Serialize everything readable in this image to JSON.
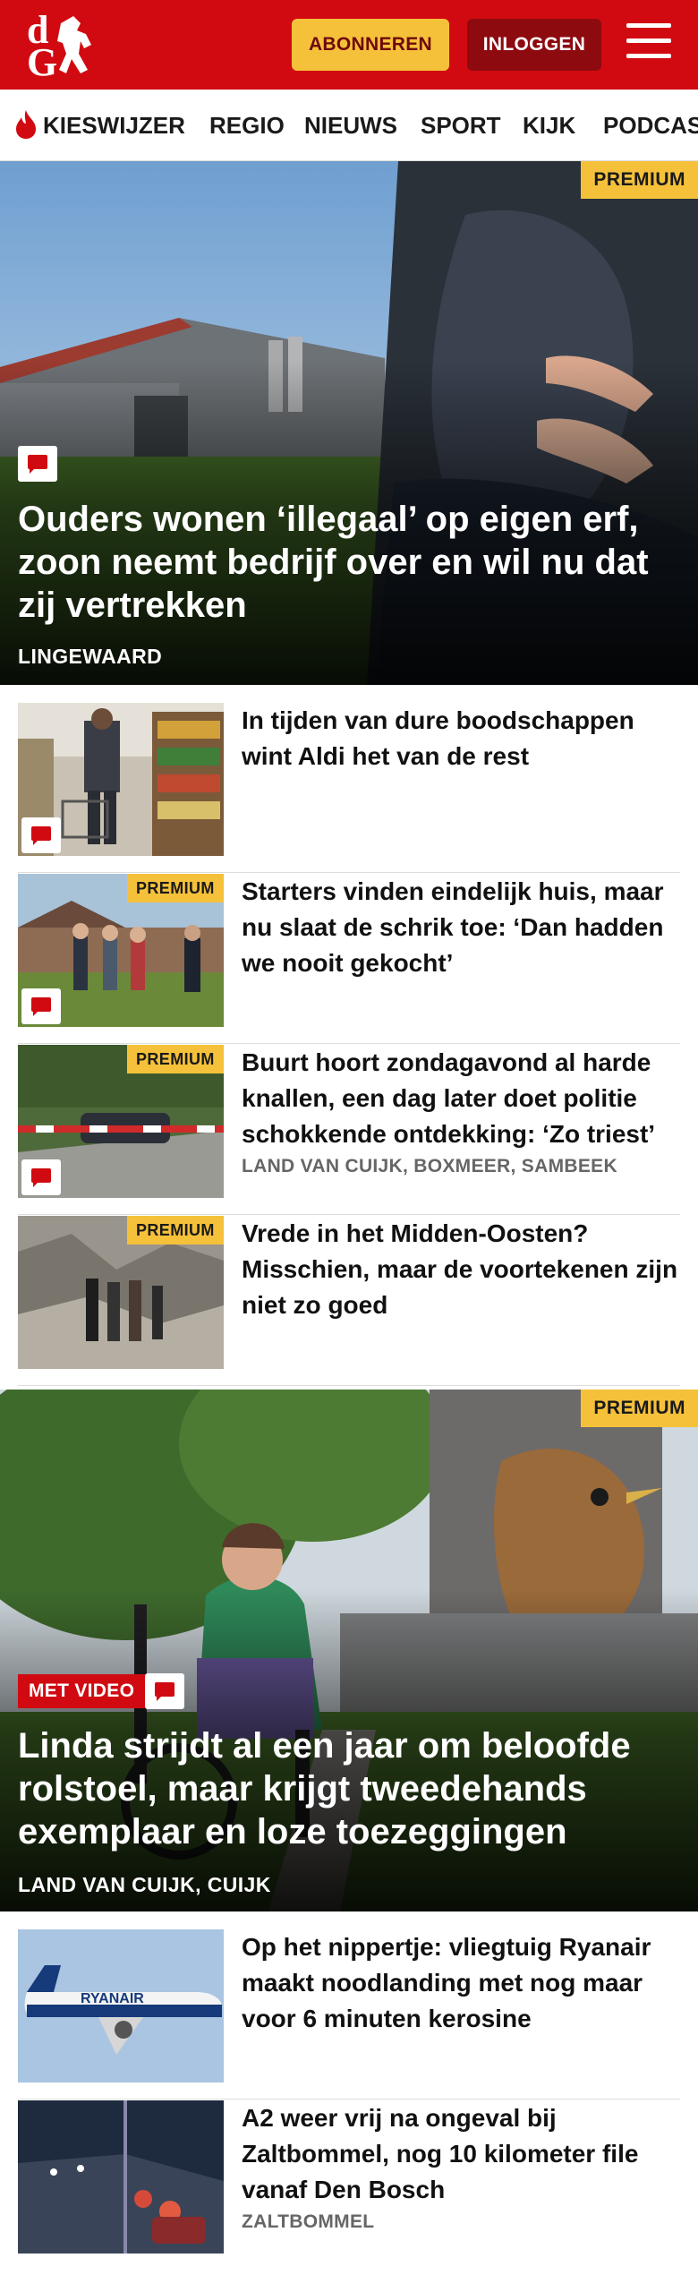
{
  "header": {
    "subscribe_label": "ABONNEREN",
    "login_label": "INLOGGEN",
    "menu_icon": "hamburger-icon",
    "brand_color": "#d10a11"
  },
  "nav": {
    "items": [
      "KIESWIJZER",
      "REGIO",
      "NIEUWS",
      "SPORT",
      "KIJK",
      "PODCAST"
    ]
  },
  "hero1": {
    "badge": "PREMIUM",
    "title": "Ouders wonen ‘illegaal’ op eigen erf, zoon neemt bedrijf over en wil nu dat zij vertrekken",
    "location": "LINGEWAARD"
  },
  "articles": [
    {
      "title": "In tijden van dure boodschappen wint Aldi het van de rest",
      "badge": "",
      "location": ""
    },
    {
      "title": "Starters vinden eindelijk huis, maar nu slaat de schrik toe: ‘Dan hadden we nooit gekocht’",
      "badge": "PREMIUM",
      "location": ""
    },
    {
      "title": "Buurt hoort zondagavond al harde knallen, een dag later doet politie schokkende ontdekking: ‘Zo triest’",
      "badge": "PREMIUM",
      "location": "LAND VAN CUIJK, BOXMEER, SAMBEEK"
    },
    {
      "title": "Vrede in het Midden-Oosten? Misschien, maar de voortekenen zijn niet zo goed",
      "badge": "PREMIUM",
      "location": ""
    }
  ],
  "hero2": {
    "badge": "PREMIUM",
    "video_label": "MET VIDEO",
    "title": "Linda strijdt al een jaar om beloofde rolstoel, maar krijgt tweedehands exemplaar en loze toezeggingen",
    "location": "LAND VAN CUIJK, CUIJK"
  },
  "articles2": [
    {
      "title": "Op het nippertje: vliegtuig Ryanair maakt noodlanding met nog maar voor 6 minuten kerosine",
      "location": ""
    },
    {
      "title": "A2 weer vrij na ongeval bij Zaltbommel, nog 10 kilometer file vanaf Den Bosch",
      "location": "ZALTBOMMEL"
    }
  ],
  "images": {
    "plane_livery": "RYANAIR"
  }
}
